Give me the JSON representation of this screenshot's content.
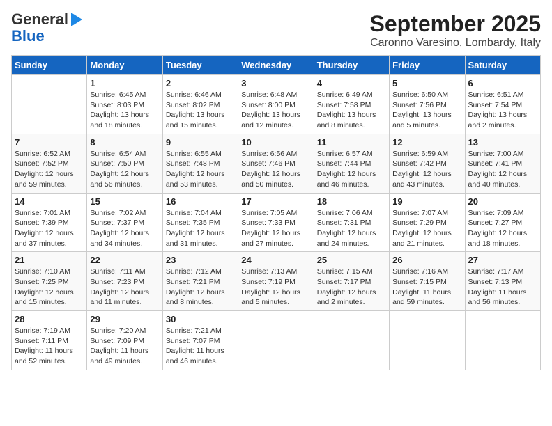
{
  "header": {
    "logo_line1": "General",
    "logo_line2": "Blue",
    "title": "September 2025",
    "subtitle": "Caronno Varesino, Lombardy, Italy"
  },
  "calendar": {
    "days_of_week": [
      "Sunday",
      "Monday",
      "Tuesday",
      "Wednesday",
      "Thursday",
      "Friday",
      "Saturday"
    ],
    "weeks": [
      [
        {
          "day": "",
          "info": ""
        },
        {
          "day": "1",
          "info": "Sunrise: 6:45 AM\nSunset: 8:03 PM\nDaylight: 13 hours\nand 18 minutes."
        },
        {
          "day": "2",
          "info": "Sunrise: 6:46 AM\nSunset: 8:02 PM\nDaylight: 13 hours\nand 15 minutes."
        },
        {
          "day": "3",
          "info": "Sunrise: 6:48 AM\nSunset: 8:00 PM\nDaylight: 13 hours\nand 12 minutes."
        },
        {
          "day": "4",
          "info": "Sunrise: 6:49 AM\nSunset: 7:58 PM\nDaylight: 13 hours\nand 8 minutes."
        },
        {
          "day": "5",
          "info": "Sunrise: 6:50 AM\nSunset: 7:56 PM\nDaylight: 13 hours\nand 5 minutes."
        },
        {
          "day": "6",
          "info": "Sunrise: 6:51 AM\nSunset: 7:54 PM\nDaylight: 13 hours\nand 2 minutes."
        }
      ],
      [
        {
          "day": "7",
          "info": "Sunrise: 6:52 AM\nSunset: 7:52 PM\nDaylight: 12 hours\nand 59 minutes."
        },
        {
          "day": "8",
          "info": "Sunrise: 6:54 AM\nSunset: 7:50 PM\nDaylight: 12 hours\nand 56 minutes."
        },
        {
          "day": "9",
          "info": "Sunrise: 6:55 AM\nSunset: 7:48 PM\nDaylight: 12 hours\nand 53 minutes."
        },
        {
          "day": "10",
          "info": "Sunrise: 6:56 AM\nSunset: 7:46 PM\nDaylight: 12 hours\nand 50 minutes."
        },
        {
          "day": "11",
          "info": "Sunrise: 6:57 AM\nSunset: 7:44 PM\nDaylight: 12 hours\nand 46 minutes."
        },
        {
          "day": "12",
          "info": "Sunrise: 6:59 AM\nSunset: 7:42 PM\nDaylight: 12 hours\nand 43 minutes."
        },
        {
          "day": "13",
          "info": "Sunrise: 7:00 AM\nSunset: 7:41 PM\nDaylight: 12 hours\nand 40 minutes."
        }
      ],
      [
        {
          "day": "14",
          "info": "Sunrise: 7:01 AM\nSunset: 7:39 PM\nDaylight: 12 hours\nand 37 minutes."
        },
        {
          "day": "15",
          "info": "Sunrise: 7:02 AM\nSunset: 7:37 PM\nDaylight: 12 hours\nand 34 minutes."
        },
        {
          "day": "16",
          "info": "Sunrise: 7:04 AM\nSunset: 7:35 PM\nDaylight: 12 hours\nand 31 minutes."
        },
        {
          "day": "17",
          "info": "Sunrise: 7:05 AM\nSunset: 7:33 PM\nDaylight: 12 hours\nand 27 minutes."
        },
        {
          "day": "18",
          "info": "Sunrise: 7:06 AM\nSunset: 7:31 PM\nDaylight: 12 hours\nand 24 minutes."
        },
        {
          "day": "19",
          "info": "Sunrise: 7:07 AM\nSunset: 7:29 PM\nDaylight: 12 hours\nand 21 minutes."
        },
        {
          "day": "20",
          "info": "Sunrise: 7:09 AM\nSunset: 7:27 PM\nDaylight: 12 hours\nand 18 minutes."
        }
      ],
      [
        {
          "day": "21",
          "info": "Sunrise: 7:10 AM\nSunset: 7:25 PM\nDaylight: 12 hours\nand 15 minutes."
        },
        {
          "day": "22",
          "info": "Sunrise: 7:11 AM\nSunset: 7:23 PM\nDaylight: 12 hours\nand 11 minutes."
        },
        {
          "day": "23",
          "info": "Sunrise: 7:12 AM\nSunset: 7:21 PM\nDaylight: 12 hours\nand 8 minutes."
        },
        {
          "day": "24",
          "info": "Sunrise: 7:13 AM\nSunset: 7:19 PM\nDaylight: 12 hours\nand 5 minutes."
        },
        {
          "day": "25",
          "info": "Sunrise: 7:15 AM\nSunset: 7:17 PM\nDaylight: 12 hours\nand 2 minutes."
        },
        {
          "day": "26",
          "info": "Sunrise: 7:16 AM\nSunset: 7:15 PM\nDaylight: 11 hours\nand 59 minutes."
        },
        {
          "day": "27",
          "info": "Sunrise: 7:17 AM\nSunset: 7:13 PM\nDaylight: 11 hours\nand 56 minutes."
        }
      ],
      [
        {
          "day": "28",
          "info": "Sunrise: 7:19 AM\nSunset: 7:11 PM\nDaylight: 11 hours\nand 52 minutes."
        },
        {
          "day": "29",
          "info": "Sunrise: 7:20 AM\nSunset: 7:09 PM\nDaylight: 11 hours\nand 49 minutes."
        },
        {
          "day": "30",
          "info": "Sunrise: 7:21 AM\nSunset: 7:07 PM\nDaylight: 11 hours\nand 46 minutes."
        },
        {
          "day": "",
          "info": ""
        },
        {
          "day": "",
          "info": ""
        },
        {
          "day": "",
          "info": ""
        },
        {
          "day": "",
          "info": ""
        }
      ]
    ]
  }
}
